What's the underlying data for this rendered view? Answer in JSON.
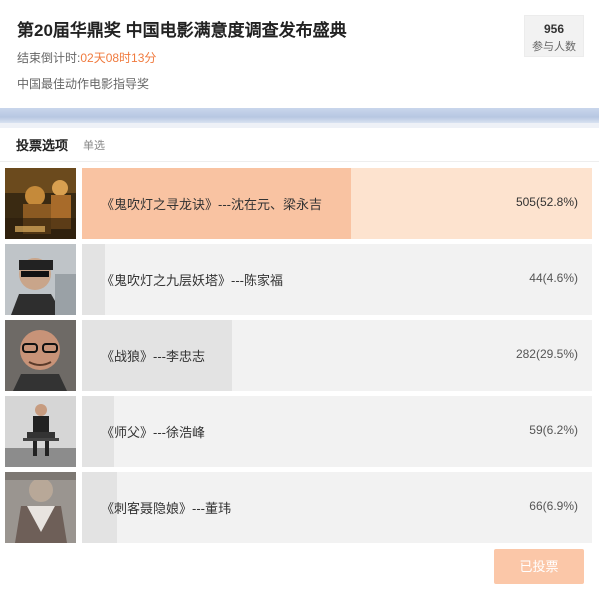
{
  "header": {
    "title": "第20届华鼎奖 中国电影满意度调查发布盛典",
    "countdown_label": "结束倒计时:",
    "countdown_value": "02天08时13分",
    "subtitle": "中国最佳动作电影指导奖",
    "participants_count": "956",
    "participants_label": "参与人数"
  },
  "section": {
    "title": "投票选项",
    "mode": "单选"
  },
  "options": [
    {
      "label": "《鬼吹灯之寻龙诀》---沈在元、梁永吉",
      "stat": "505(52.8%)",
      "percent": 52.8,
      "selected": true,
      "thumb": "movie-poster-image"
    },
    {
      "label": "《鬼吹灯之九层妖塔》---陈家福",
      "stat": "44(4.6%)",
      "percent": 4.6,
      "selected": false,
      "thumb": "person-photo"
    },
    {
      "label": "《战狼》---李忠志",
      "stat": "282(29.5%)",
      "percent": 29.5,
      "selected": false,
      "thumb": "person-photo"
    },
    {
      "label": "《师父》---徐浩峰",
      "stat": "59(6.2%)",
      "percent": 6.2,
      "selected": false,
      "thumb": "person-photo"
    },
    {
      "label": "《刺客聂隐娘》---董玮",
      "stat": "66(6.9%)",
      "percent": 6.9,
      "selected": false,
      "thumb": "person-photo"
    }
  ],
  "vote_button": {
    "label": "已投票"
  },
  "colors": {
    "accent": "#f07a3e",
    "selected_bar": "#f9c3a2",
    "selected_track": "#fde3cf",
    "bar": "#e3e3e3",
    "track": "#f2f2f2",
    "button": "#fbc7a8"
  }
}
